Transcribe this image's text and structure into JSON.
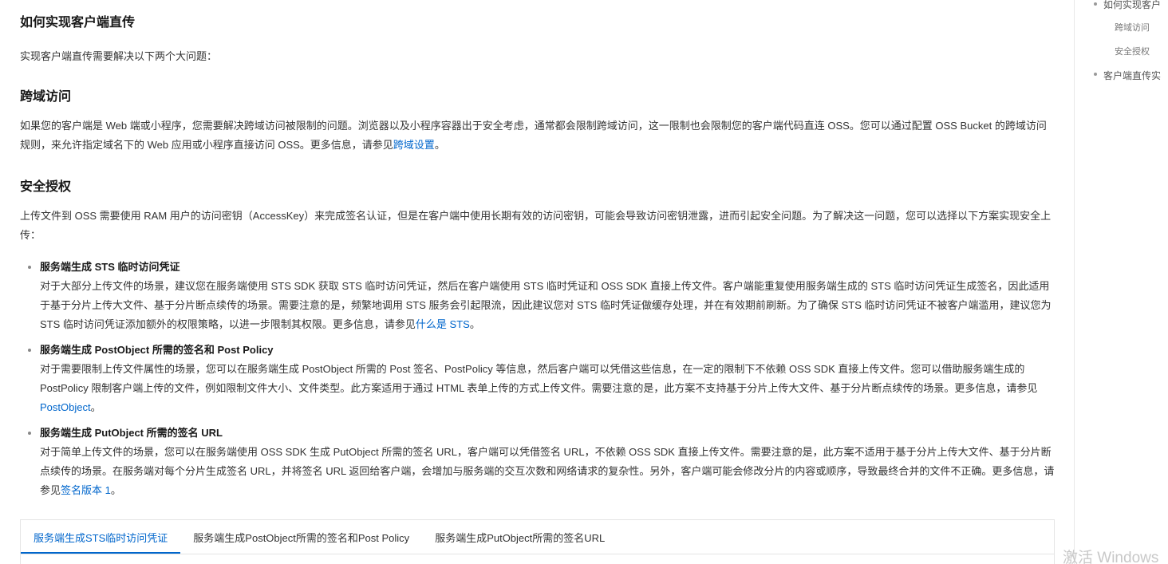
{
  "article": {
    "title": "如何实现客户端直传",
    "intro": "实现客户端直传需要解决以下两个大问题：",
    "sections": [
      {
        "heading": "跨域访问",
        "text": "如果您的客户端是 Web 端或小程序，您需要解决跨域访问被限制的问题。浏览器以及小程序容器出于安全考虑，通常都会限制跨域访问，这一限制也会限制您的客户端代码直连 OSS。您可以通过配置 OSS Bucket 的跨域访问规则，来允许指定域名下的 Web 应用或小程序直接访问 OSS。更多信息，请参见",
        "link": "跨域设置",
        "tail": "。"
      },
      {
        "heading": "安全授权",
        "text": "上传文件到 OSS 需要使用 RAM 用户的访问密钥（AccessKey）来完成签名认证，但是在客户端中使用长期有效的访问密钥，可能会导致访问密钥泄露，进而引起安全问题。为了解决这一问题，您可以选择以下方案实现安全上传："
      }
    ],
    "bullets": [
      {
        "title": "服务端生成 STS 临时访问凭证",
        "text": "对于大部分上传文件的场景，建议您在服务端使用 STS SDK 获取 STS 临时访问凭证，然后在客户端使用 STS 临时凭证和 OSS SDK 直接上传文件。客户端能重复使用服务端生成的 STS 临时访问凭证生成签名，因此适用于基于分片上传大文件、基于分片断点续传的场景。需要注意的是，频繁地调用 STS 服务会引起限流，因此建议您对 STS 临时凭证做缓存处理，并在有效期前刷新。为了确保 STS 临时访问凭证不被客户端滥用，建议您为 STS 临时访问凭证添加额外的权限策略，以进一步限制其权限。更多信息，请参见",
        "link": "什么是 STS",
        "tail": "。"
      },
      {
        "title": "服务端生成 PostObject 所需的签名和 Post Policy",
        "text": "对于需要限制上传文件属性的场景，您可以在服务端生成 PostObject 所需的 Post 签名、PostPolicy 等信息，然后客户端可以凭借这些信息，在一定的限制下不依赖 OSS SDK 直接上传文件。您可以借助服务端生成的 PostPolicy 限制客户端上传的文件，例如限制文件大小、文件类型。此方案适用于通过 HTML 表单上传的方式上传文件。需要注意的是，此方案不支持基于分片上传大文件、基于分片断点续传的场景。更多信息，请参见 ",
        "link": "PostObject",
        "tail": "。"
      },
      {
        "title": "服务端生成 PutObject 所需的签名 URL",
        "text": "对于简单上传文件的场景，您可以在服务端使用 OSS SDK 生成 PutObject 所需的签名 URL，客户端可以凭借签名 URL，不依赖 OSS SDK 直接上传文件。需要注意的是，此方案不适用于基于分片上传大文件、基于分片断点续传的场景。在服务端对每个分片生成签名 URL，并将签名 URL 返回给客户端，会增加与服务端的交互次数和网络请求的复杂性。另外，客户端可能会修改分片的内容或顺序，导致最终合并的文件不正确。更多信息，请参见",
        "link": "签名版本 1",
        "tail": "。"
      }
    ],
    "tabs": [
      {
        "label": "服务端生成STS临时访问凭证",
        "active": true
      },
      {
        "label": "服务端生成PostObject所需的签名和Post Policy",
        "active": false
      },
      {
        "label": "服务端生成PutObject所需的签名URL",
        "active": false
      }
    ]
  },
  "toc": {
    "items": [
      {
        "label": "如何实现客户",
        "level": 1
      },
      {
        "label": "跨域访问",
        "level": 2
      },
      {
        "label": "安全授权",
        "level": 2
      },
      {
        "label": "客户端直传实",
        "level": 1
      }
    ]
  },
  "overlay": {
    "activation_text": "激活 Windows"
  },
  "colors": {
    "link": "#0066cc",
    "heading": "#181818",
    "body_text": "#333333"
  }
}
